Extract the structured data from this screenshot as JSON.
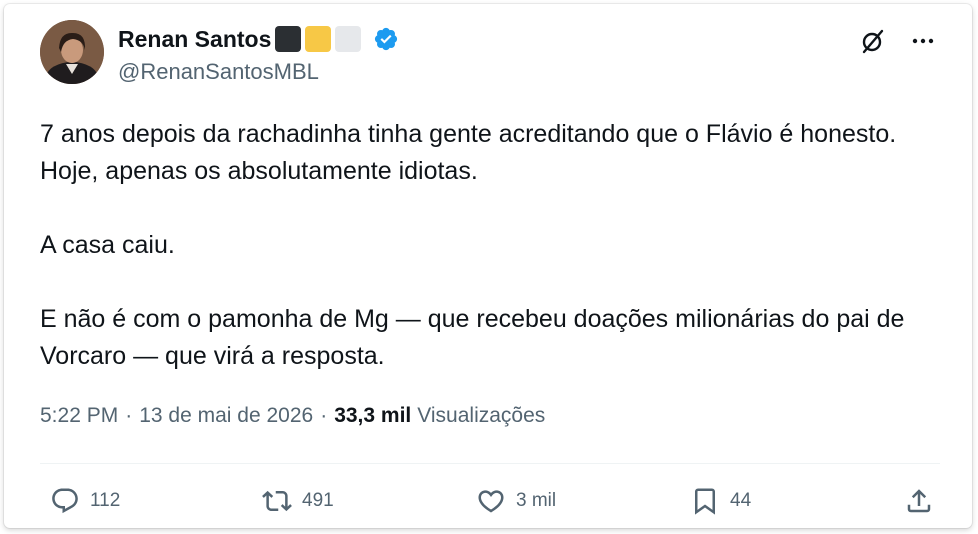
{
  "tweet": {
    "author": {
      "display_name": "Renan Santos",
      "handle": "@RenanSantosMBL",
      "name_emoji_colors": [
        "#2b2f33",
        "#f7c846",
        "#e6e8eb"
      ],
      "verified_color": "#1d9bf0"
    },
    "text_paragraphs": [
      "7 anos depois da rachadinha tinha gente acreditando que o Flávio é honesto. Hoje, apenas os absolutamente idiotas.",
      "A casa caiu.",
      "E não é com o pamonha de Mg — que recebeu doações milionárias do pai de Vorcaro — que virá a resposta."
    ],
    "time": "5:22 PM",
    "date": "13 de mai de 2026",
    "views_count": "33,3 mil",
    "views_label": "Visualizações",
    "separator": "·",
    "stats": {
      "replies": "112",
      "retweets": "491",
      "likes": "3 mil",
      "bookmarks": "44"
    },
    "icons": {
      "avatar": "profile-photo",
      "verified": "verified-badge-icon",
      "grok": "grok-icon",
      "more": "more-horizontal-icon",
      "reply": "reply-icon",
      "retweet": "retweet-icon",
      "like": "heart-icon",
      "bookmark": "bookmark-icon",
      "share": "share-icon"
    },
    "colors": {
      "text": "#0f1419",
      "secondary": "#536471",
      "divider": "#eff3f4"
    }
  }
}
